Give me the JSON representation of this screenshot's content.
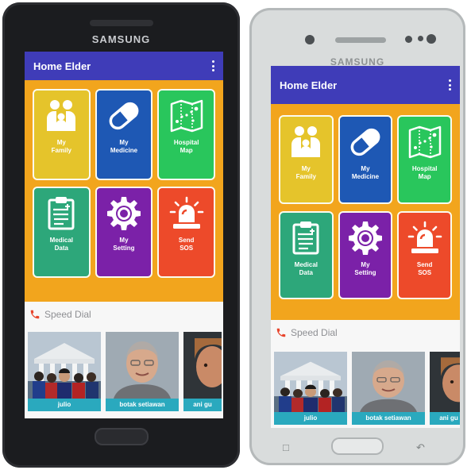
{
  "device": {
    "brand": "SAMSUNG"
  },
  "app": {
    "title": "Home Elder"
  },
  "tiles": [
    {
      "label_line1": "My",
      "label_line2": "Family",
      "color": "#e5c42b",
      "icon": "family-icon"
    },
    {
      "label_line1": "My",
      "label_line2": "Medicine",
      "color": "#1e58b4",
      "icon": "pill-icon"
    },
    {
      "label_line1": "Hospital",
      "label_line2": "Map",
      "color": "#29c65c",
      "icon": "map-icon"
    },
    {
      "label_line1": "Medical",
      "label_line2": "Data",
      "color": "#2da77a",
      "icon": "clipboard-icon"
    },
    {
      "label_line1": "My",
      "label_line2": "Setting",
      "color": "#7b21a8",
      "icon": "gear-icon"
    },
    {
      "label_line1": "Send",
      "label_line2": "SOS",
      "color": "#ed4a2a",
      "icon": "siren-icon"
    }
  ],
  "speed_dial": {
    "title": "Speed Dial",
    "contacts": [
      {
        "name": "julio"
      },
      {
        "name": "botak setiawan"
      },
      {
        "name": "ani gu"
      }
    ]
  },
  "colors": {
    "app_bar": "#3f3cb8",
    "background": "#f2a51d",
    "name_strip": "#2aa9be"
  }
}
